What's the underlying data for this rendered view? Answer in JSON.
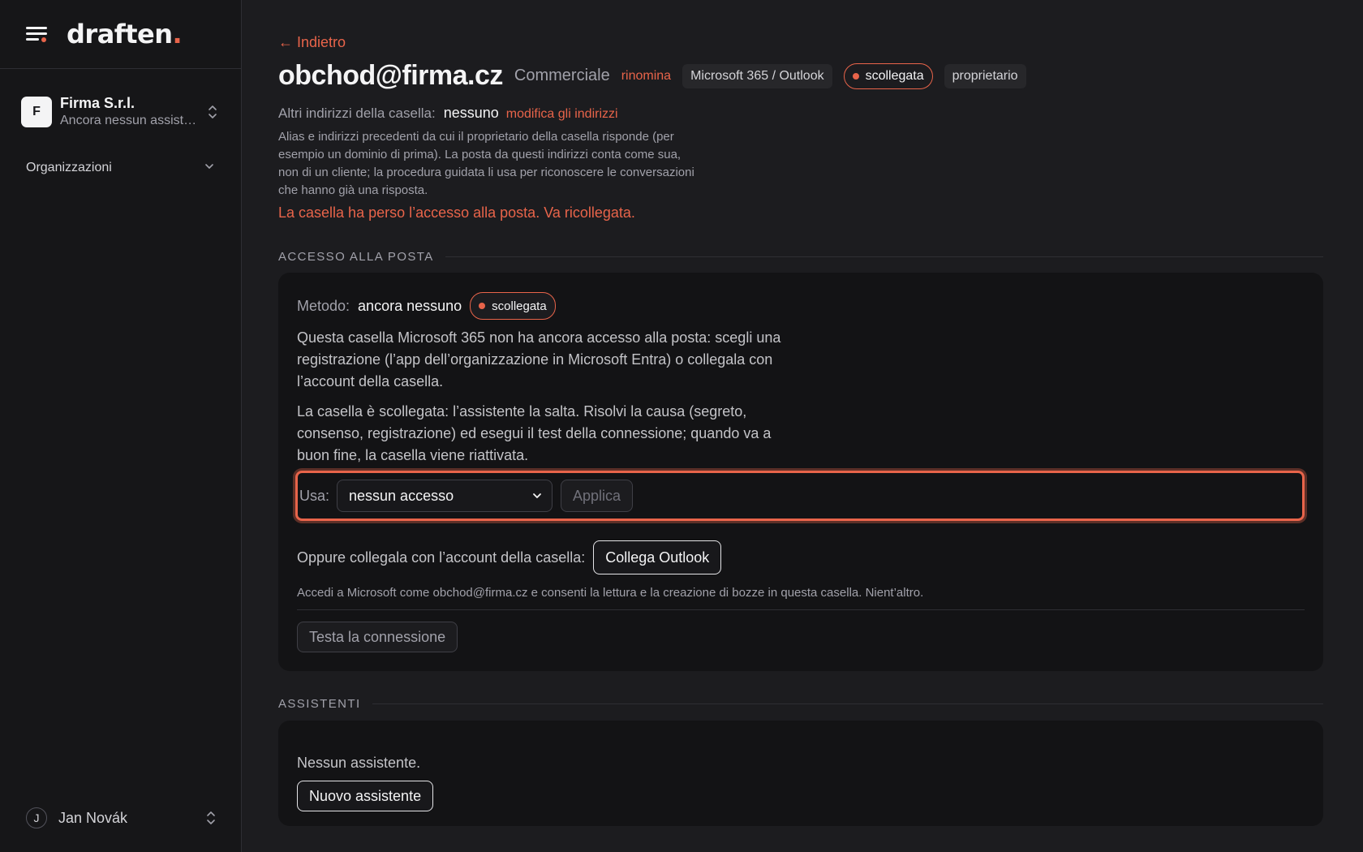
{
  "sidebar": {
    "logo": "draften",
    "logo_dot": ".",
    "org": {
      "initial": "F",
      "name": "Firma S.r.l.",
      "subtitle": "Ancora nessun assistente"
    },
    "nav_organizations": "Organizzazioni",
    "user": {
      "initial": "J",
      "name": "Jan Novák"
    }
  },
  "header": {
    "back": "← Indietro",
    "title": "obchod@firma.cz",
    "subtitle": "Commerciale",
    "rename": "rinomina",
    "provider": "Microsoft 365 / Outlook",
    "status": "scollegata",
    "role": "proprietario"
  },
  "aliases": {
    "label": "Altri indirizzi della casella:",
    "value": "nessuno",
    "edit": "modifica gli indirizzi",
    "help": "Alias e indirizzi precedenti da cui il proprietario della casella risponde (per esempio un dominio di prima). La posta da questi indirizzi conta come sua, non di un cliente; la procedura guidata li usa per riconoscere le conversazioni che hanno già una risposta."
  },
  "error_message": "La casella ha perso l’accesso alla posta. Va ricollegata.",
  "mail_access": {
    "section_title": "ACCESSO ALLA POSTA",
    "method_label": "Metodo:",
    "method_value": "ancora nessuno",
    "status": "scollegata",
    "para1": "Questa casella Microsoft 365 non ha ancora accesso alla posta: scegli una registrazione (l’app dell’organizzazione in Microsoft Entra) o collegala con l’account della casella.",
    "para2": "La casella è scollegata: l’assistente la salta. Risolvi la causa (segreto, consenso, registrazione) ed esegui il test della connessione; quando va a buon fine, la casella viene riattivata.",
    "use_label": "Usa:",
    "select_value": "nessun accesso",
    "apply": "Applica",
    "or_label": "Oppure collegala con l’account della casella:",
    "connect_button": "Collega Outlook",
    "note": "Accedi a Microsoft come obchod@firma.cz e consenti la lettura e la creazione di bozze in questa casella. Nient’altro.",
    "test_button": "Testa la connessione"
  },
  "assistants": {
    "section_title": "ASSISTENTI",
    "empty": "Nessun assistente.",
    "new_button": "Nuovo assistente"
  },
  "colors": {
    "accent": "#e8644a",
    "background": "#1c1c1f",
    "sidebar": "#161618",
    "card": "#131315"
  },
  "icons": [
    "menu-icon",
    "chevron-up-down-icon",
    "chevron-down-icon",
    "status-dot-icon"
  ]
}
